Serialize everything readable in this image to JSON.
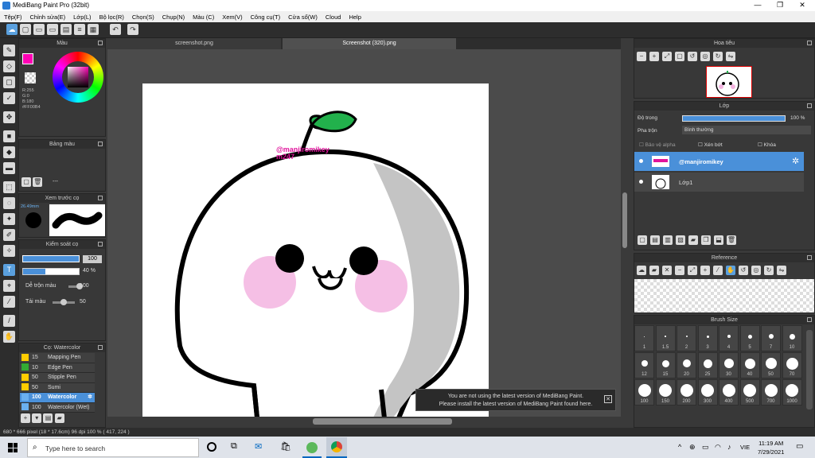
{
  "window": {
    "title": "MediBang Paint Pro (32bit)",
    "min": "—",
    "max": "❐",
    "close": "✕"
  },
  "menu": [
    "Tệp(F)",
    "Chỉnh sửa(E)",
    "Lớp(L)",
    "Bộ lọc(R)",
    "Chọn(S)",
    "Chụp(N)",
    "Màu (C)",
    "Xem(V)",
    "Công cụ(T)",
    "Cửa sổ(W)",
    "Cloud",
    "Help"
  ],
  "color_panel": {
    "title": "Màu",
    "r": "R:255",
    "g": "G:0",
    "b": "B:180",
    "hex": "#FF00B4",
    "accent": "#FF00B4"
  },
  "palette_panel": {
    "title": "Bảng màu",
    "dash": "---"
  },
  "preview_panel": {
    "title": "Xem trước cọ",
    "size": "26.49mm"
  },
  "brush_control": {
    "title": "Kiểm soát cọ",
    "size_value": "100",
    "opacity_value": "40 %",
    "blend_label": "Dễ trộn màu",
    "blend_value": "100",
    "reload_label": "Tải màu",
    "reload_value": "50"
  },
  "brush_list": {
    "title": "Cọ: Watercolor",
    "items": [
      {
        "num": "15",
        "name": "Mapping Pen",
        "color": "#ffcc00"
      },
      {
        "num": "10",
        "name": "Edge Pen",
        "color": "#33aa33"
      },
      {
        "num": "50",
        "name": "Stipple Pen",
        "color": "#ffcc00"
      },
      {
        "num": "50",
        "name": "Sumi",
        "color": "#ffcc00"
      },
      {
        "num": "100",
        "name": "Watercolor",
        "color": "#6ab0f0",
        "selected": true
      },
      {
        "num": "100",
        "name": "Watercolor (Wet)",
        "color": "#6ab0f0"
      }
    ]
  },
  "tabs": [
    {
      "label": "screenshot.png"
    },
    {
      "label": "Screenshot (320).png"
    }
  ],
  "canvas": {
    "watermark": "@manjiromikey",
    "watermark_sub": "m247"
  },
  "navigator": {
    "title": "Hoa tiêu"
  },
  "layer_panel": {
    "title": "Lớp",
    "opacity_label": "Độ trong",
    "opacity_value": "100 %",
    "blend_label": "Pha trộn",
    "blend_value": "Bình thường",
    "protect_alpha": "Bảo vệ alpha",
    "clipping": "Xén bớt",
    "lock": "Khóa",
    "layers": [
      {
        "name": "@manjiromikey",
        "selected": true
      },
      {
        "name": "Lớp1",
        "selected": false
      }
    ]
  },
  "reference_panel": {
    "title": "Reference"
  },
  "brush_size_panel": {
    "title": "Brush Size",
    "sizes": [
      "1",
      "1.5",
      "2",
      "3",
      "4",
      "5",
      "7",
      "10",
      "12",
      "15",
      "20",
      "25",
      "30",
      "40",
      "50",
      "70",
      "100",
      "150",
      "200",
      "300",
      "400",
      "500",
      "700",
      "1000"
    ]
  },
  "notice": {
    "line1": "You are not using the latest version of MediBang Paint.",
    "line2": "Please install the latest version of MediBang Paint found here.",
    "close": "✕"
  },
  "status": "680 * 666 pixel   (18 * 17.6cm)   96 dpi   100 %   ( 417, 224 )",
  "taskbar": {
    "search_placeholder": "Type here to search",
    "time": "11:19 AM",
    "date": "7/29/2021",
    "lang": "VIE"
  }
}
